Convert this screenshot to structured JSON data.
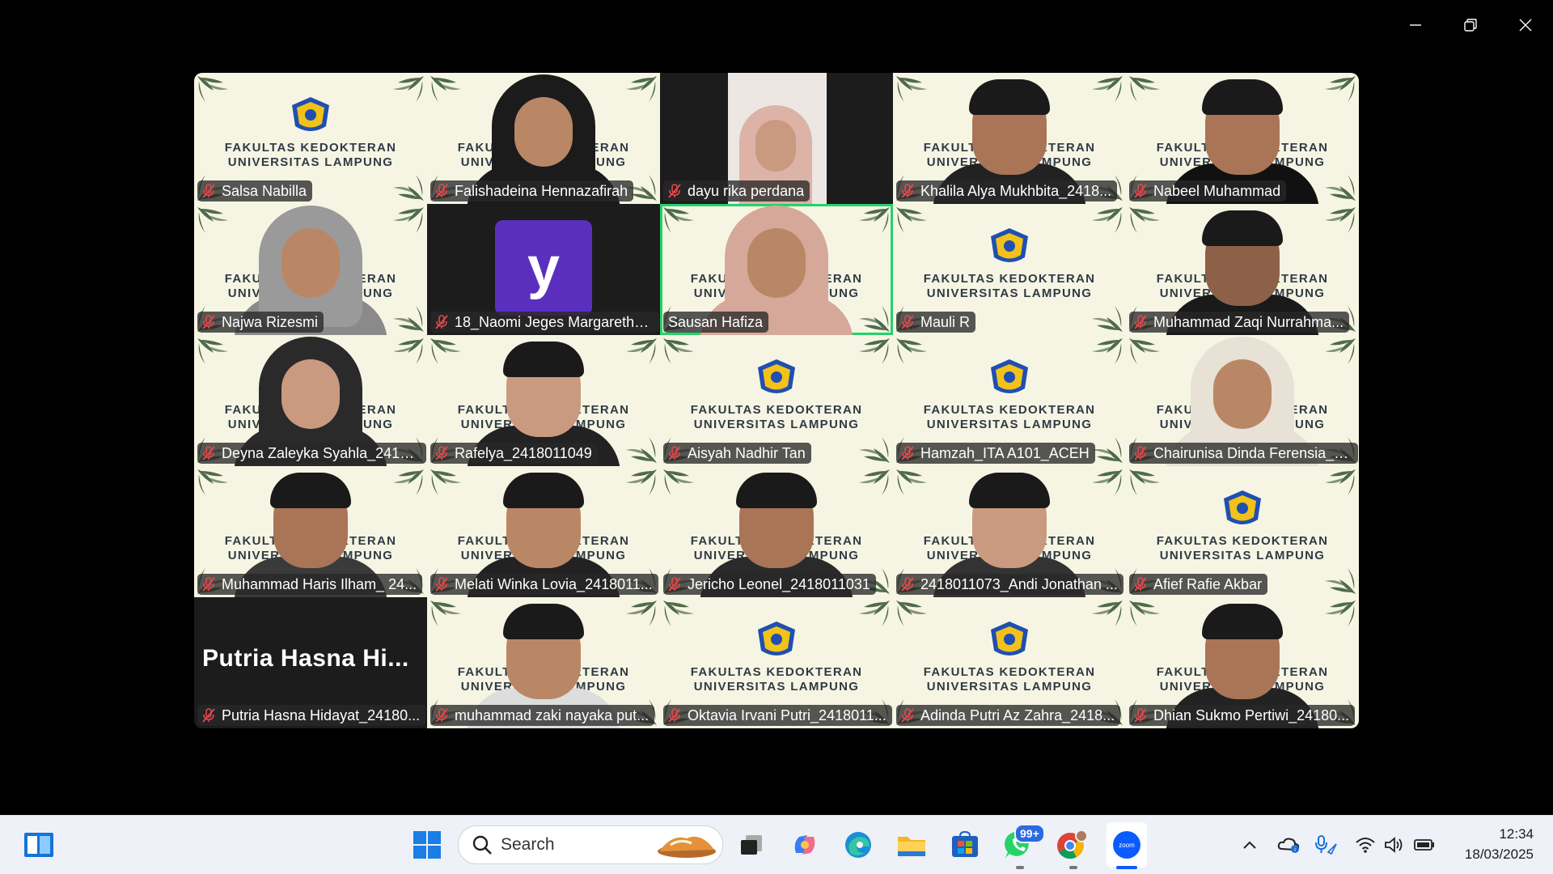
{
  "window": {
    "controls": [
      "minimize",
      "restore",
      "close"
    ]
  },
  "background_text": {
    "line1": "FAKULTAS KEDOKTERAN",
    "line2": "UNIVERSITAS LAMPUNG"
  },
  "participants": [
    {
      "name": "Salsa Nabilla",
      "muted": true
    },
    {
      "name": "Falishadeina Hennazafirah",
      "muted": true
    },
    {
      "name": "dayu rika perdana",
      "muted": true
    },
    {
      "name": "Khalila Alya Mukhbita_2418...",
      "muted": true
    },
    {
      "name": "Nabeel Muhammad",
      "muted": true
    },
    {
      "name": "Najwa Rizesmi",
      "muted": true
    },
    {
      "name": "18_Naomi Jeges Margaretha...",
      "muted": true,
      "avatar_letter": "y"
    },
    {
      "name": "Sausan Hafiza",
      "muted": false,
      "active_speaker": true
    },
    {
      "name": "Mauli R",
      "muted": true
    },
    {
      "name": "Muhammad Zaqi Nurrahma...",
      "muted": true
    },
    {
      "name": "Deyna Zaleyka Syahla_24180...",
      "muted": true
    },
    {
      "name": "Rafelya_2418011049",
      "muted": true
    },
    {
      "name": "Aisyah Nadhir Tan",
      "muted": true
    },
    {
      "name": "Hamzah_ITA A101_ACEH",
      "muted": true
    },
    {
      "name": "Chairunisa Dinda Ferensia_2...",
      "muted": true
    },
    {
      "name": "Muhammad Haris Ilham_ 24...",
      "muted": true
    },
    {
      "name": "Melati Winka Lovia_2418011...",
      "muted": true
    },
    {
      "name": "Jericho Leonel_2418011031",
      "muted": true
    },
    {
      "name": "2418011073_Andi Jonathan ...",
      "muted": true
    },
    {
      "name": "Afief Rafie Akbar",
      "muted": true
    },
    {
      "name": "Putria Hasna Hidayat_24180...",
      "muted": true,
      "big_name": "Putria Hasna Hi..."
    },
    {
      "name": "muhammad zaki nayaka put...",
      "muted": true
    },
    {
      "name": "Oktavia Irvani Putri_2418011...",
      "muted": true
    },
    {
      "name": "Adinda Putri Az Zahra_2418...",
      "muted": true
    },
    {
      "name": "Dhian Sukmo Pertiwi_24180...",
      "muted": true
    }
  ],
  "taskbar": {
    "search_placeholder": "Search",
    "whatsapp_badge": "99+",
    "time": "12:34",
    "date": "18/03/2025",
    "icons": [
      "widgets-icon",
      "windows-start-icon",
      "search-icon",
      "task-view-icon",
      "copilot-icon",
      "edge-icon",
      "file-explorer-icon",
      "store-icon",
      "whatsapp-icon",
      "chrome-icon",
      "zoom-icon",
      "chevron-up-icon",
      "onedrive-icon",
      "mic-icon",
      "wifi-icon",
      "volume-icon",
      "battery-icon"
    ]
  },
  "colors": {
    "active_border": "#22d36a",
    "tile_bg": "#f6f5e4",
    "muted_icon": "#e5484d",
    "zoom_blue": "#0b5cff"
  }
}
